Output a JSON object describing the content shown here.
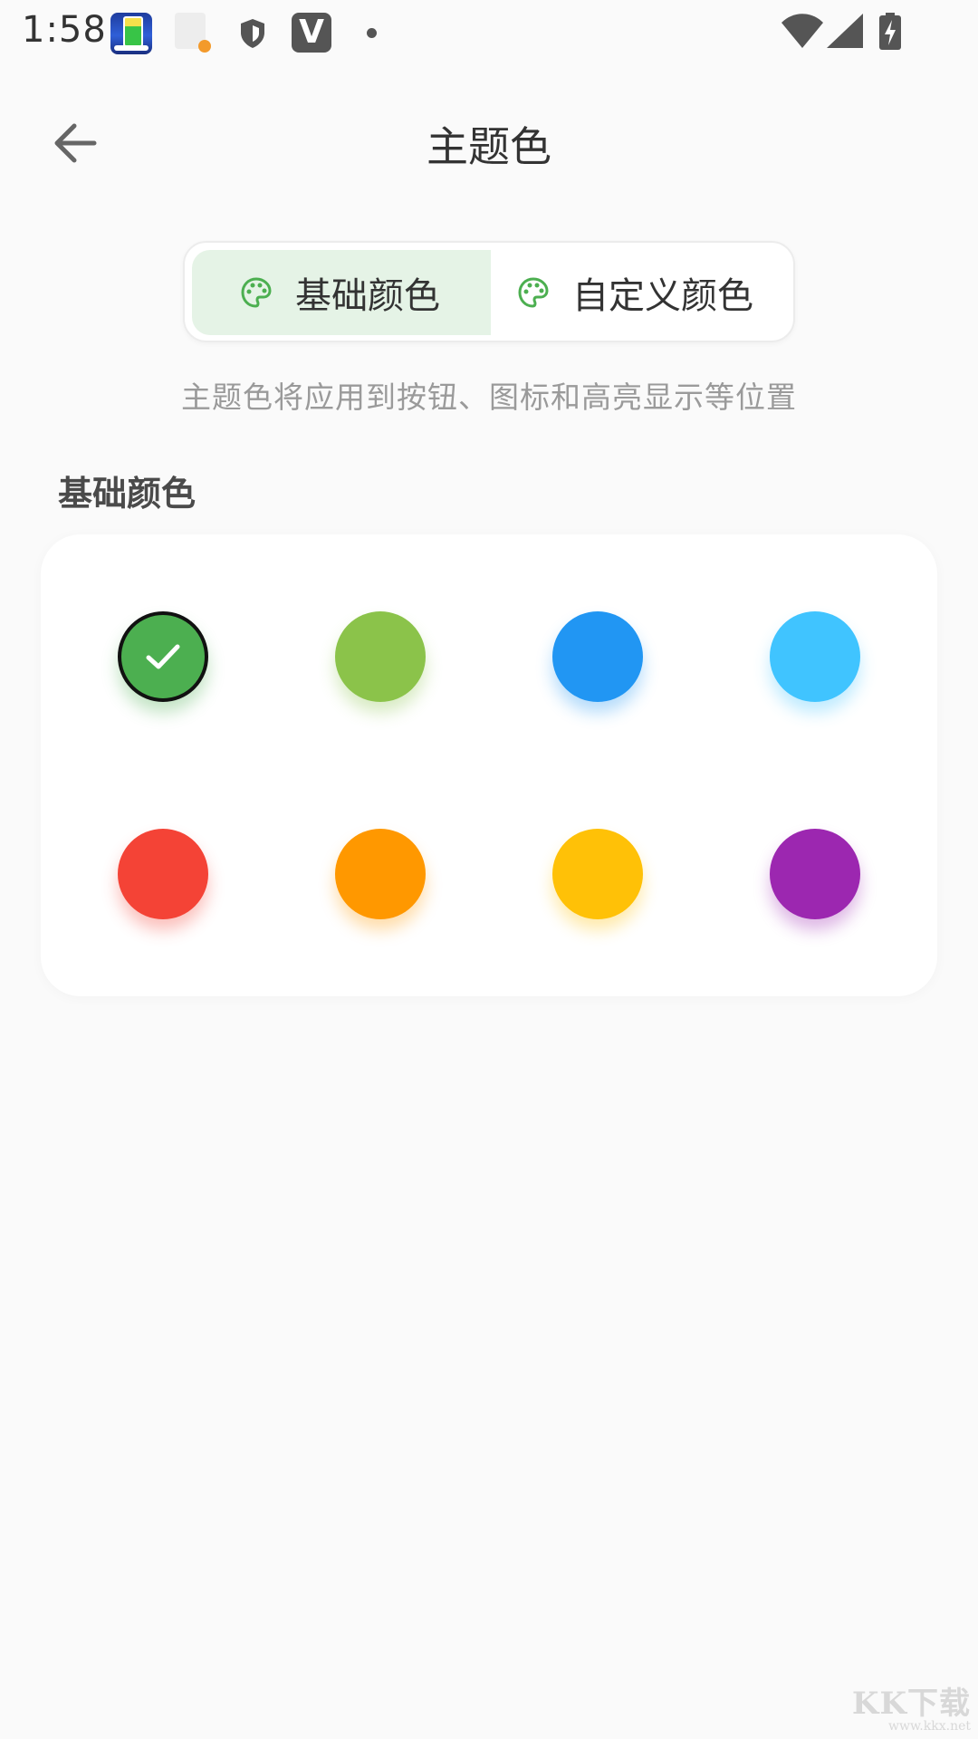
{
  "status_bar": {
    "time": "1:58",
    "notification_icons": [
      "battery-app-icon",
      "document-alert-icon",
      "shield-icon",
      "v-app-icon",
      "dot-icon"
    ],
    "v_badge_letter": "V",
    "system_icons": [
      "wifi-icon",
      "cell-signal-icon",
      "battery-charging-icon"
    ]
  },
  "app_bar": {
    "title": "主题色",
    "back_icon": "arrow-left-icon"
  },
  "tabs": [
    {
      "label": "基础颜色",
      "icon": "palette-icon",
      "selected": true
    },
    {
      "label": "自定义颜色",
      "icon": "palette-icon",
      "selected": false
    }
  ],
  "description": "主题色将应用到按钮、图标和高亮显示等位置",
  "section_title": "基础颜色",
  "colors": [
    {
      "name": "green",
      "hex": "#4CAF50",
      "selected": true
    },
    {
      "name": "light-green",
      "hex": "#8BC34A",
      "selected": false
    },
    {
      "name": "blue",
      "hex": "#2196F3",
      "selected": false
    },
    {
      "name": "light-blue",
      "hex": "#40C4FF",
      "selected": false
    },
    {
      "name": "red",
      "hex": "#F44336",
      "selected": false
    },
    {
      "name": "orange",
      "hex": "#FF9800",
      "selected": false
    },
    {
      "name": "amber",
      "hex": "#FFC107",
      "selected": false
    },
    {
      "name": "purple",
      "hex": "#9C27B0",
      "selected": false
    }
  ],
  "accent_color": "#4CAF50",
  "watermark": {
    "main": "KK下载",
    "sub": "www.kkx.net"
  }
}
